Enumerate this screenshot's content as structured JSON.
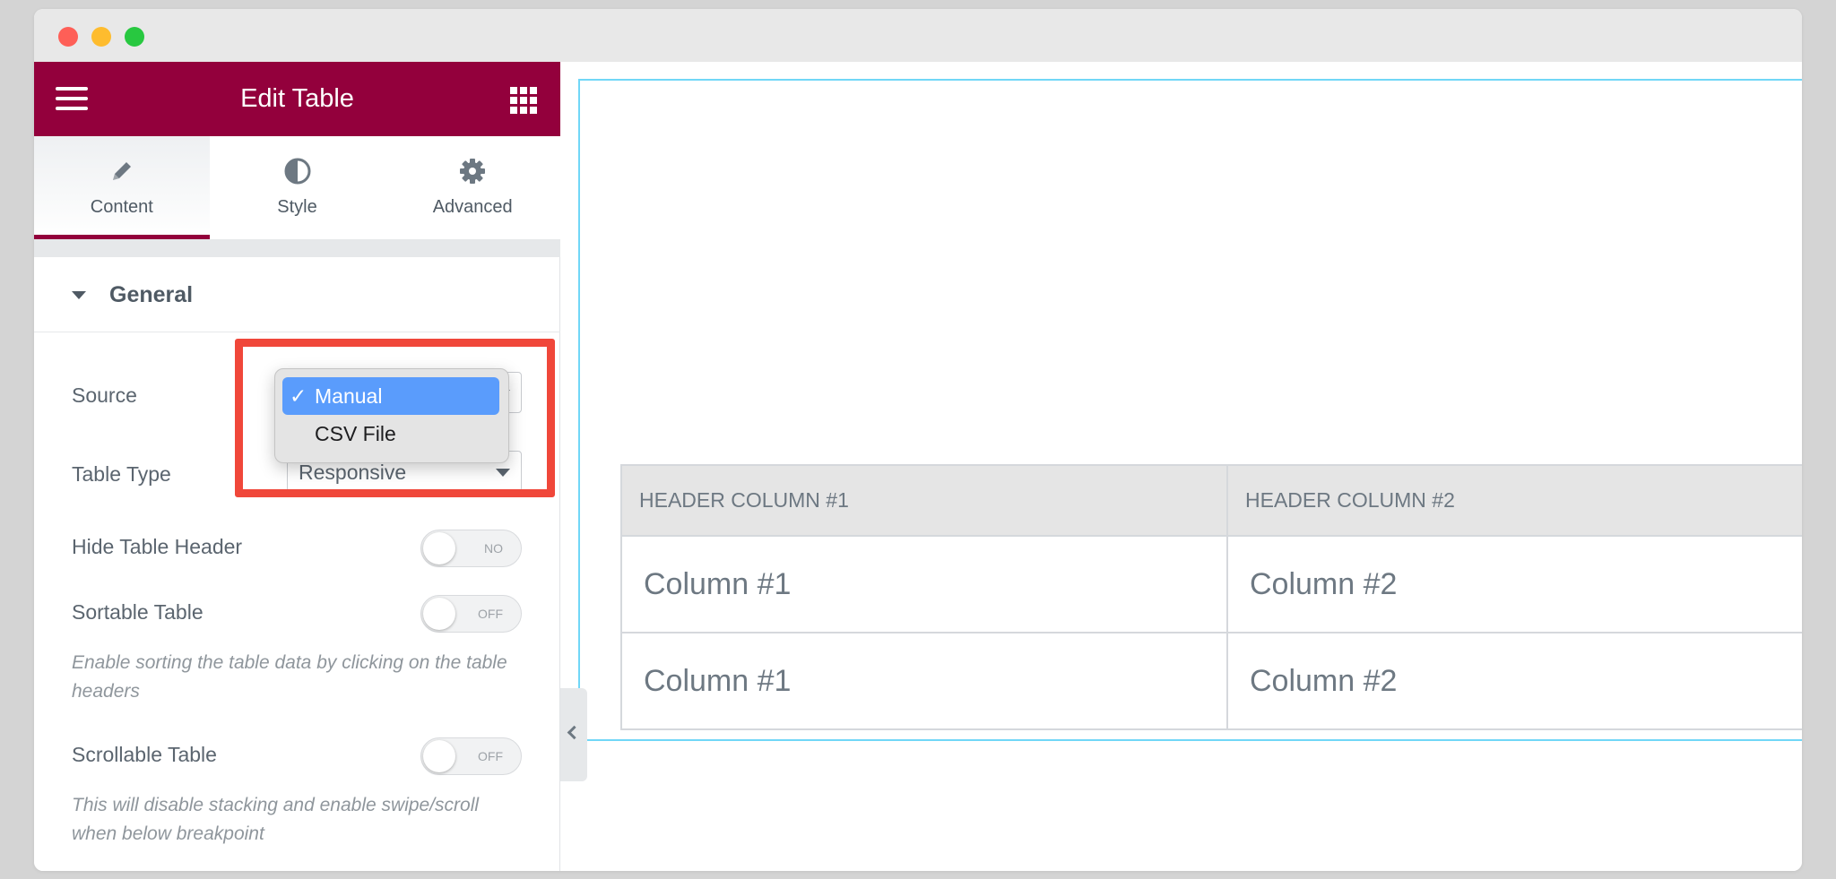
{
  "window": {
    "traffic_lights": [
      "close",
      "minimize",
      "zoom"
    ]
  },
  "panel": {
    "title": "Edit Table",
    "menu_icon": "hamburger-menu-icon",
    "apps_icon": "grid-apps-icon",
    "tabs": [
      {
        "label": "Content",
        "icon": "pencil-icon",
        "active": true
      },
      {
        "label": "Style",
        "icon": "half-circle-icon",
        "active": false
      },
      {
        "label": "Advanced",
        "icon": "gear-icon",
        "active": false
      }
    ],
    "section": {
      "title": "General",
      "expanded": true
    },
    "source": {
      "label": "Source",
      "options": [
        "Manual",
        "CSV File"
      ],
      "selected": "Manual",
      "check": "✓"
    },
    "table_type": {
      "label": "Table Type",
      "value": "Responsive"
    },
    "hide_header": {
      "label": "Hide Table Header",
      "state": "NO"
    },
    "sortable": {
      "label": "Sortable Table",
      "state": "OFF",
      "description": "Enable sorting the table data by clicking on the table headers"
    },
    "scrollable": {
      "label": "Scrollable Table",
      "state": "OFF",
      "description": "This will disable stacking and enable swipe/scroll when below breakpoint"
    },
    "highlight_color": "#f0473a",
    "brand_color": "#93003c"
  },
  "table": {
    "headers": [
      "HEADER COLUMN #1",
      "HEADER COLUMN #2"
    ],
    "rows": [
      [
        "Column #1",
        "Column #2"
      ],
      [
        "Column #1",
        "Column #2"
      ]
    ]
  }
}
